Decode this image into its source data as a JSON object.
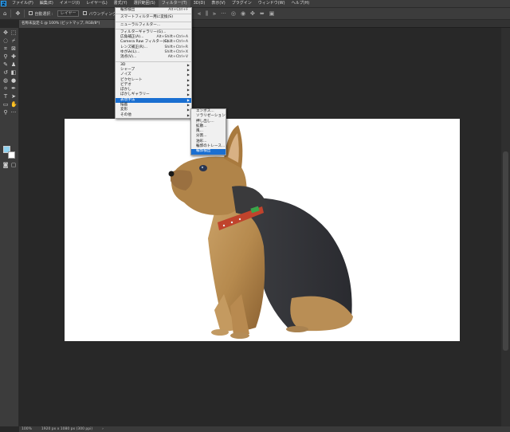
{
  "app": {
    "logo": "Ps"
  },
  "menubar": {
    "items": [
      "ファイル(F)",
      "編集(E)",
      "イメージ(I)",
      "レイヤー(L)",
      "書式(Y)",
      "選択範囲(S)",
      "フィルター(T)",
      "3D(D)",
      "表示(V)",
      "プラグイン",
      "ウィンドウ(W)",
      "ヘルプ(H)"
    ],
    "active_index": 6
  },
  "options": {
    "auto_select_label": "自動選択 :",
    "layer_select": "レイヤー",
    "transform_label": "バウンディング",
    "mode_3d": "3D モード"
  },
  "tab": {
    "title": "名称未設定-1 @ 100% (ビットマップ, RGB/8*)",
    "close": "×"
  },
  "statusbar": {
    "zoom": "100%",
    "doc_info": "1920 px x 1080 px (300 ppi)",
    "arrow": "›"
  },
  "filter_menu": {
    "items": [
      {
        "label": "輪郭検出",
        "shortcut": "Alt+Ctrl+F"
      },
      {
        "divider": true
      },
      {
        "label": "スマートフィルター用に変換(S)"
      },
      {
        "divider": true
      },
      {
        "label": "ニューラルフィルター..."
      },
      {
        "divider": true
      },
      {
        "label": "フィルターギャラリー(G)..."
      },
      {
        "label": "広角補正(A)...",
        "shortcut": "Alt+Shift+Ctrl+A"
      },
      {
        "label": "Camera Raw フィルター(C)...",
        "shortcut": "Shift+Ctrl+A"
      },
      {
        "label": "レンズ補正(R)...",
        "shortcut": "Shift+Ctrl+R"
      },
      {
        "label": "ゆがみ(L)...",
        "shortcut": "Shift+Ctrl+X"
      },
      {
        "label": "消点(V)...",
        "shortcut": "Alt+Ctrl+V"
      },
      {
        "divider": true
      },
      {
        "label": "3D",
        "submenu": true
      },
      {
        "label": "シャープ",
        "submenu": true
      },
      {
        "label": "ノイズ",
        "submenu": true
      },
      {
        "label": "ピクセレート",
        "submenu": true
      },
      {
        "label": "ビデオ",
        "submenu": true
      },
      {
        "label": "ぼかし",
        "submenu": true
      },
      {
        "label": "ぼかしギャラリー",
        "submenu": true
      },
      {
        "label": "表現手法",
        "submenu": true,
        "highlighted": true
      },
      {
        "label": "描画",
        "submenu": true
      },
      {
        "label": "変形",
        "submenu": true
      },
      {
        "label": "その他",
        "submenu": true
      }
    ]
  },
  "stylize_submenu": {
    "items": [
      {
        "label": "エンボス..."
      },
      {
        "label": "ソラリゼーション"
      },
      {
        "label": "押し出し..."
      },
      {
        "label": "拡散..."
      },
      {
        "label": "風..."
      },
      {
        "label": "分割..."
      },
      {
        "label": "油彩..."
      },
      {
        "label": "輪郭のトレース..."
      },
      {
        "label": "輪郭検出",
        "highlighted": true
      }
    ]
  },
  "colors": {
    "accent": "#1a6fd1",
    "foreground_swatch": "#8fd2ef",
    "background_swatch": "#ffffff"
  }
}
